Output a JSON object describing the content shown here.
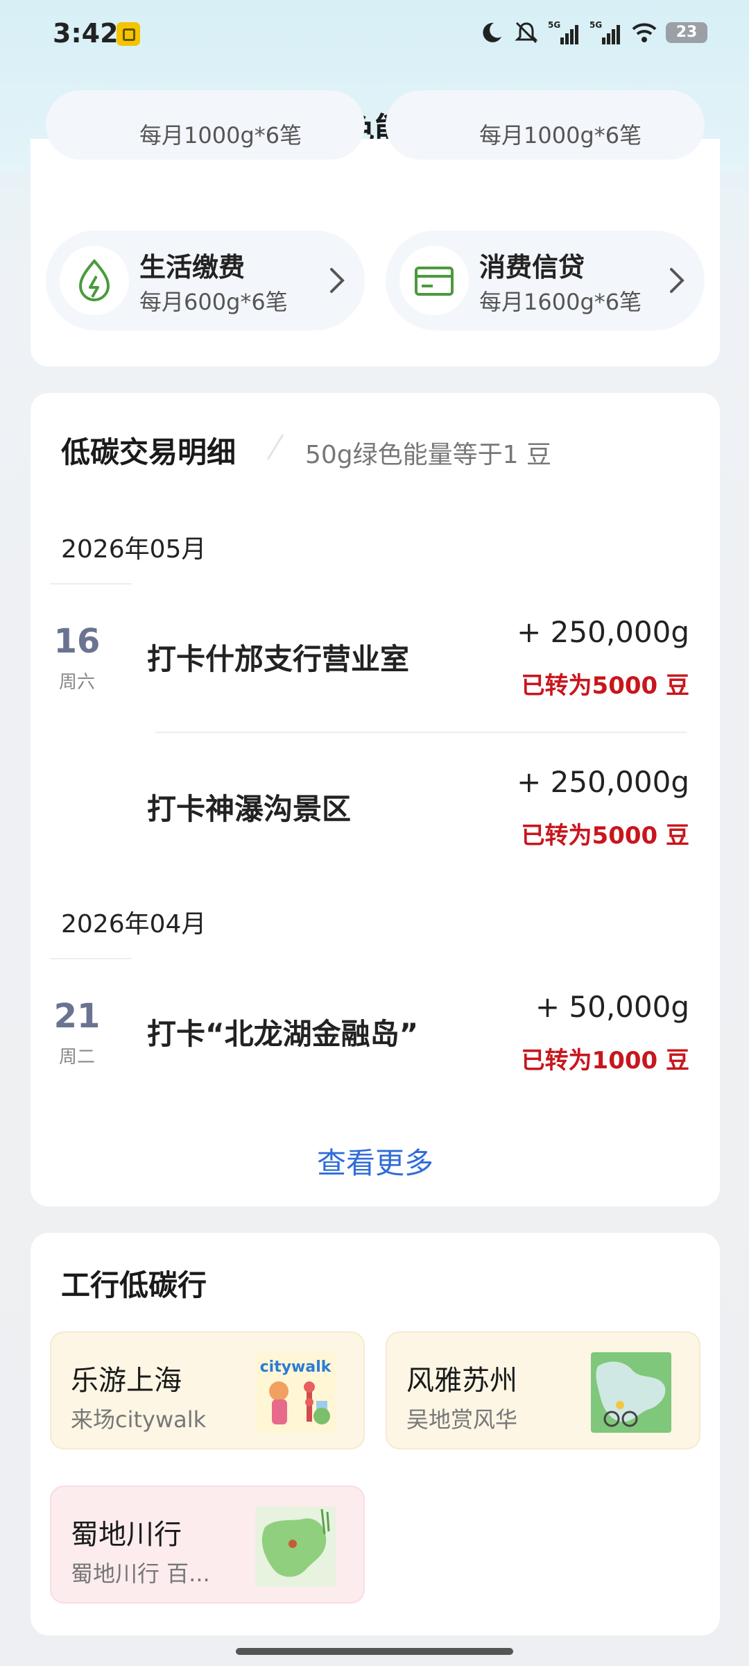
{
  "status_bar": {
    "time": "3:42",
    "network_1": "5G",
    "network_2": "5G",
    "battery": "23"
  },
  "header": {
    "title": "绿色能量"
  },
  "top_card": {
    "partial_row_left_sub": "每月1000g*6笔",
    "partial_row_right_sub": "每月1000g*6笔",
    "items": [
      {
        "title": "生活缴费",
        "subtitle": "每月600g*6笔",
        "icon": "leaf-lightning-icon"
      },
      {
        "title": "消费信贷",
        "subtitle": "每月1600g*6笔",
        "icon": "card-icon"
      }
    ]
  },
  "transactions": {
    "title": "低碳交易明细",
    "subtitle": "50g绿色能量等于1 豆",
    "groups": [
      {
        "month": "2026年05月",
        "entries": [
          {
            "day": "16",
            "weekday": "周六",
            "name": "打卡什邡支行营业室",
            "amount": "+ 250,000g",
            "converted": "已转为5000 豆"
          },
          {
            "day": "",
            "weekday": "",
            "name": "打卡神瀑沟景区",
            "amount": "+ 250,000g",
            "converted": "已转为5000 豆"
          }
        ]
      },
      {
        "month": "2026年04月",
        "entries": [
          {
            "day": "21",
            "weekday": "周二",
            "name": "打卡“北龙湖金融岛”",
            "amount": "+ 50,000g",
            "converted": "已转为1000 豆"
          }
        ]
      }
    ],
    "more_label": "查看更多"
  },
  "low_carbon": {
    "title": "工行低碳行",
    "items": [
      {
        "title": "乐游上海",
        "subtitle": "来场citywalk",
        "image_text": "citywalk",
        "bg": "#fdf6e4"
      },
      {
        "title": "风雅苏州",
        "subtitle": "吴地赏风华",
        "bg": "#fdf6e4"
      },
      {
        "title": "蜀地川行",
        "subtitle": "蜀地川行 百...",
        "bg": "#fdecee"
      }
    ]
  },
  "colors": {
    "accent_green": "#4a9a3d",
    "red": "#c8161d",
    "link_blue": "#2f6cd8",
    "day_color": "#6a738f"
  }
}
